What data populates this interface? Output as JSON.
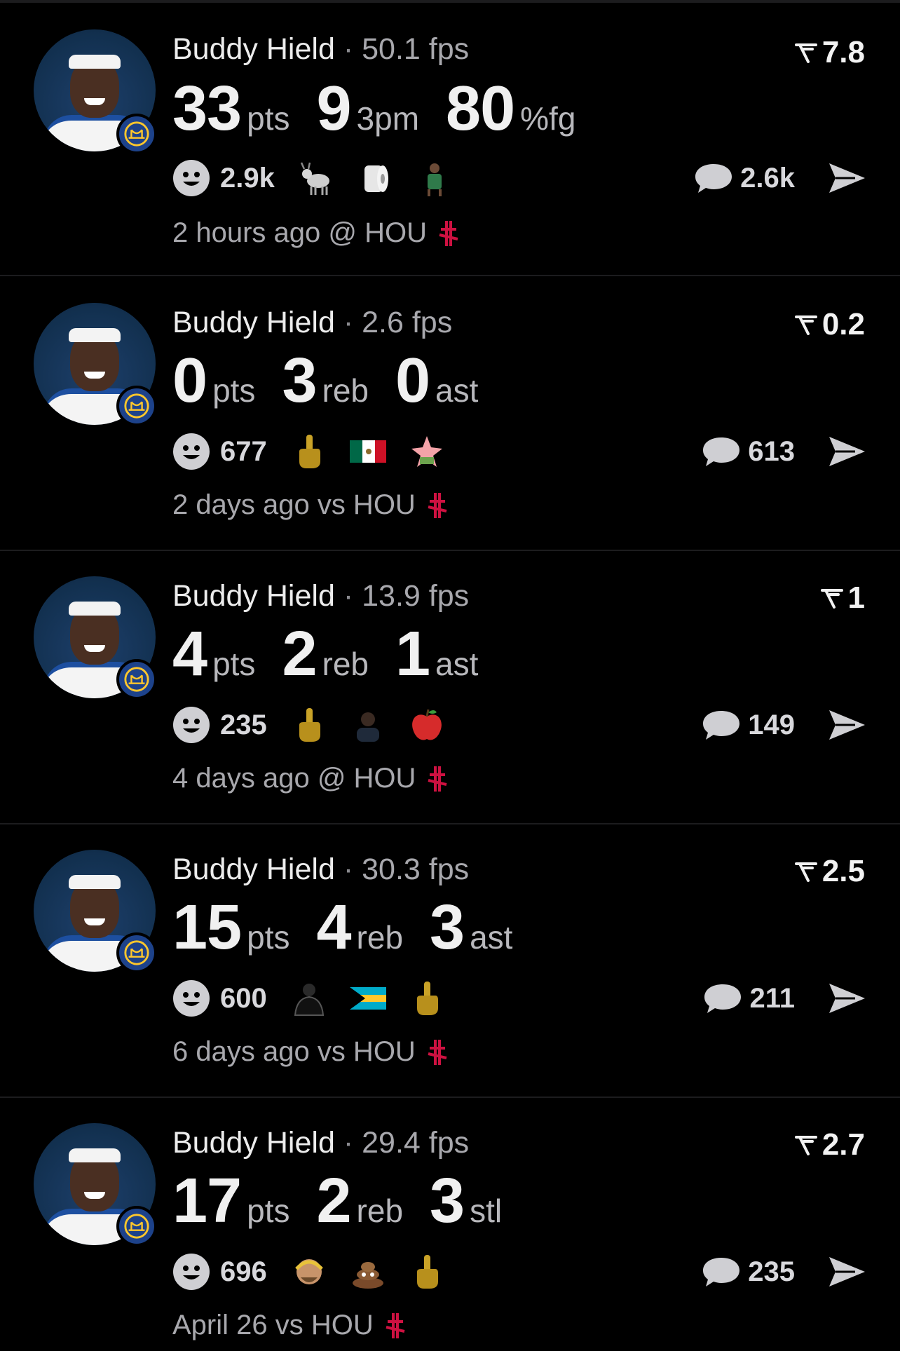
{
  "colors": {
    "background": "#000000",
    "divider": "#1c1c1e",
    "primary_text": "#ececec",
    "secondary_text": "#a8a8ad",
    "rockets_red": "#ce1141",
    "warriors_blue": "#1d428a",
    "warriors_gold": "#ffc72c"
  },
  "posts": [
    {
      "player": "Buddy Hield",
      "separator": "·",
      "fps": "50.1 fps",
      "rating": "7.8",
      "stats": [
        {
          "value": "33",
          "unit": "pts"
        },
        {
          "value": "9",
          "unit": "3pm"
        },
        {
          "value": "80",
          "unit": "%fg"
        }
      ],
      "reaction_count": "2.9k",
      "reaction_emojis": [
        "goat-emoji",
        "toilet-paper-emoji",
        "player-sticker-emoji"
      ],
      "comment_count": "2.6k",
      "time": "2 hours ago @ HOU"
    },
    {
      "player": "Buddy Hield",
      "separator": "·",
      "fps": "2.6 fps",
      "rating": "0.2",
      "stats": [
        {
          "value": "0",
          "unit": "pts"
        },
        {
          "value": "3",
          "unit": "reb"
        },
        {
          "value": "0",
          "unit": "ast"
        }
      ],
      "reaction_count": "677",
      "reaction_emojis": [
        "middle-finger-emoji",
        "mexico-flag-emoji",
        "patrick-star-sticker"
      ],
      "comment_count": "613",
      "time": "2 days ago vs HOU"
    },
    {
      "player": "Buddy Hield",
      "separator": "·",
      "fps": "13.9 fps",
      "rating": "1",
      "stats": [
        {
          "value": "4",
          "unit": "pts"
        },
        {
          "value": "2",
          "unit": "reb"
        },
        {
          "value": "1",
          "unit": "ast"
        }
      ],
      "reaction_count": "235",
      "reaction_emojis": [
        "middle-finger-emoji",
        "person-sticker-emoji",
        "red-apple-emoji"
      ],
      "comment_count": "149",
      "time": "4 days ago @ HOU"
    },
    {
      "player": "Buddy Hield",
      "separator": "·",
      "fps": "30.3 fps",
      "rating": "2.5",
      "stats": [
        {
          "value": "15",
          "unit": "pts"
        },
        {
          "value": "4",
          "unit": "reb"
        },
        {
          "value": "3",
          "unit": "ast"
        }
      ],
      "reaction_count": "600",
      "reaction_emojis": [
        "brooklyn-player-sticker",
        "bahamas-flag-emoji",
        "middle-finger-emoji"
      ],
      "comment_count": "211",
      "time": "6 days ago vs HOU"
    },
    {
      "player": "Buddy Hield",
      "separator": "·",
      "fps": "29.4 fps",
      "rating": "2.7",
      "stats": [
        {
          "value": "17",
          "unit": "pts"
        },
        {
          "value": "2",
          "unit": "reb"
        },
        {
          "value": "3",
          "unit": "stl"
        }
      ],
      "reaction_count": "696",
      "reaction_emojis": [
        "player-face-sticker",
        "pile-of-poo-emoji",
        "middle-finger-emoji"
      ],
      "comment_count": "235",
      "time": "April 26 vs HOU"
    }
  ]
}
